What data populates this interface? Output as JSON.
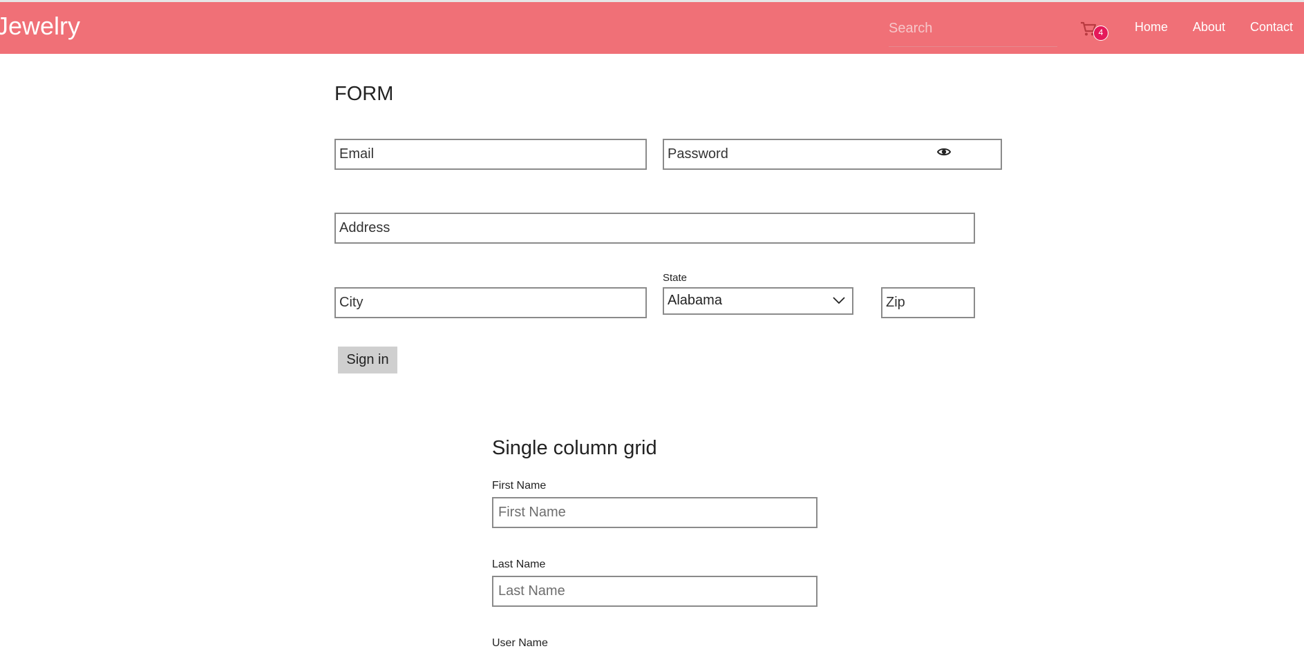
{
  "header": {
    "brand": "Jewelry",
    "search_placeholder": "Search",
    "cart_count": "4",
    "nav": [
      "Home",
      "About",
      "Contact"
    ]
  },
  "form": {
    "title": "FORM",
    "email_placeholder": "Email",
    "password_placeholder": "Password",
    "address_placeholder": "Address",
    "city_placeholder": "City",
    "state_label": "State",
    "state_value": "Alabama",
    "zip_placeholder": "Zip",
    "signin_label": "Sign in"
  },
  "grid": {
    "title": "Single column grid",
    "first_name_label": "First Name",
    "first_name_placeholder": "First Name",
    "last_name_label": "Last Name",
    "last_name_placeholder": "Last Name",
    "user_name_label": "User Name"
  },
  "colors": {
    "navbar": "#f07077",
    "badge": "#e5195a",
    "button": "#cfcfcf"
  }
}
